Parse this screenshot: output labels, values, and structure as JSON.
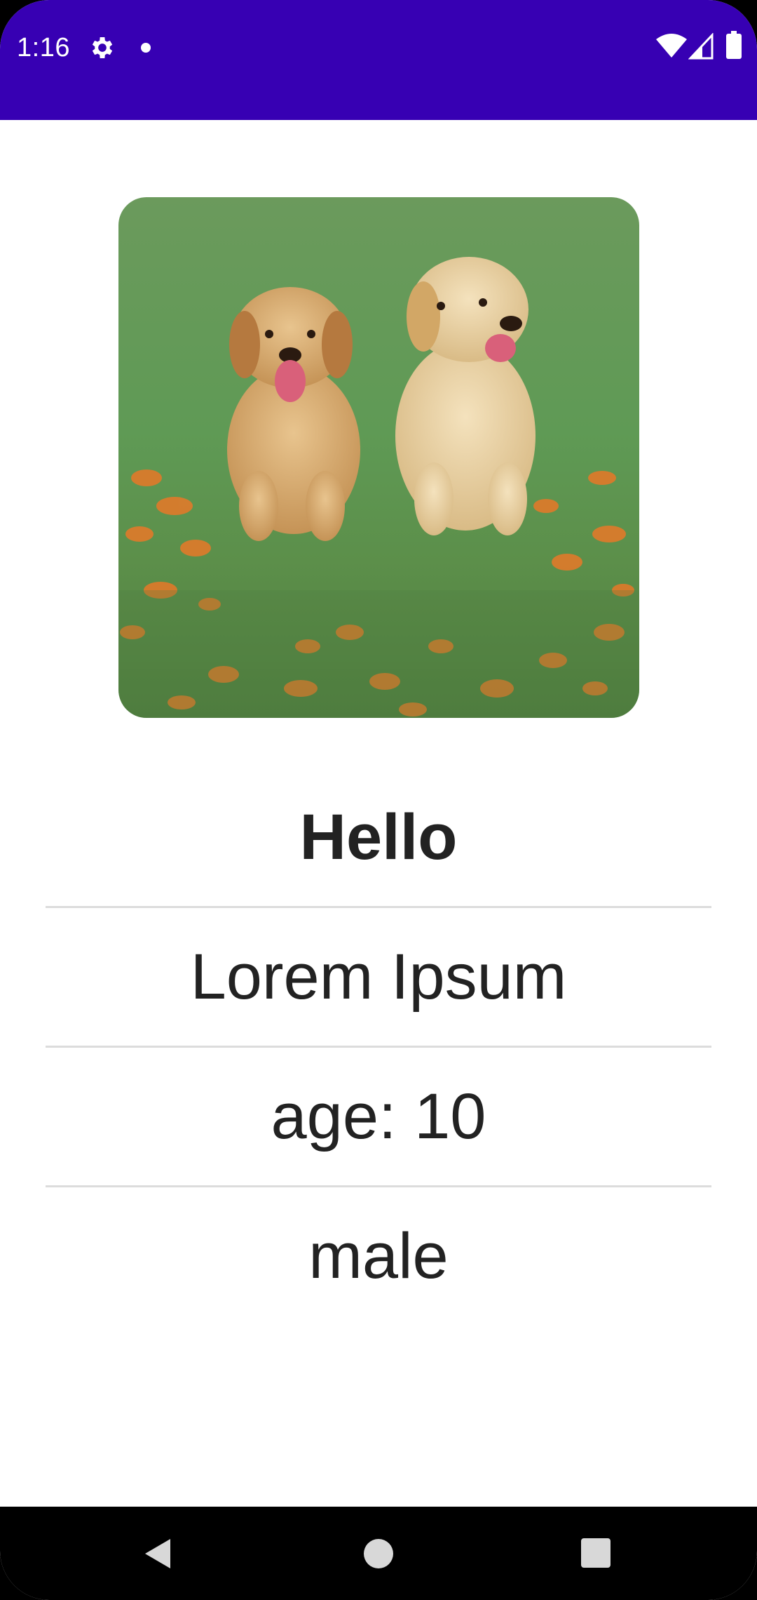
{
  "status_bar": {
    "time": "1:16",
    "background_color": "#3700b3",
    "icons": [
      "gear-icon",
      "notification-dot-icon",
      "wifi-icon",
      "cell-signal-icon",
      "battery-icon"
    ]
  },
  "profile": {
    "photo_icon": "puppies-photo",
    "greeting": "Hello",
    "name": "Lorem Ipsum",
    "age": "age: 10",
    "gender": "male"
  },
  "nav_bar": {
    "icons": [
      "back-icon",
      "home-icon",
      "recents-icon"
    ]
  }
}
